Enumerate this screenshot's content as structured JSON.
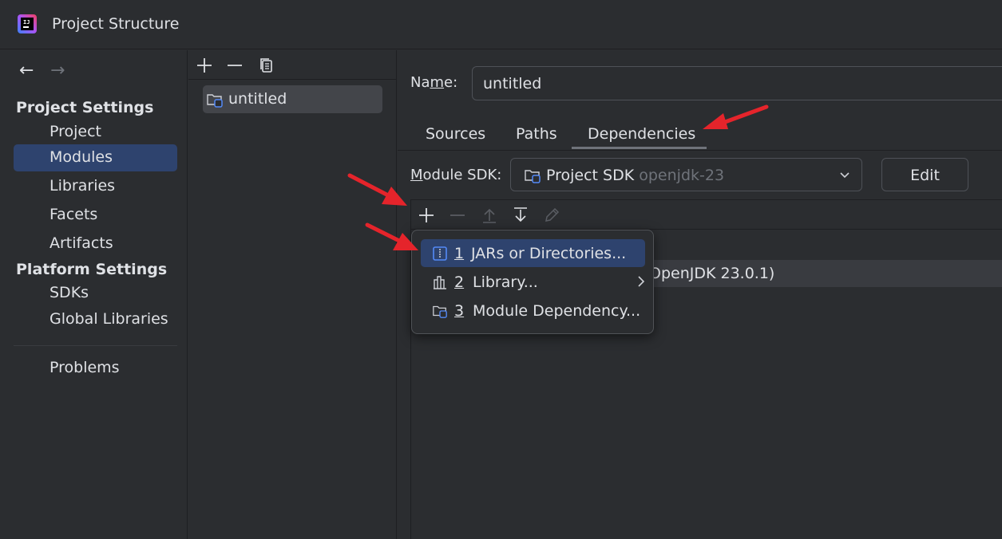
{
  "window": {
    "title": "Project Structure"
  },
  "nav": {
    "back_glyph": "←",
    "forward_glyph": "→",
    "project_settings_heading": "Project Settings",
    "project_settings_items": [
      "Project",
      "Modules",
      "Libraries",
      "Facets",
      "Artifacts"
    ],
    "platform_settings_heading": "Platform Settings",
    "platform_settings_items": [
      "SDKs",
      "Global Libraries"
    ],
    "problems": "Problems",
    "selected": "Modules"
  },
  "modules": {
    "items": [
      "untitled"
    ]
  },
  "module": {
    "name_label_pre": "Na",
    "name_label_mnemonic": "m",
    "name_label_post": "e:",
    "name_value": "untitled",
    "tabs": [
      "Sources",
      "Paths",
      "Dependencies"
    ],
    "active_tab": "Dependencies",
    "sdk_label_mnemonic": "M",
    "sdk_label_rest": "odule SDK:",
    "sdk_name": "Project SDK",
    "sdk_version": "openjdk-23",
    "edit_label": "Edit",
    "dependency_row_partial": "OpenJDK 23.0.1)"
  },
  "popup": {
    "items": [
      {
        "mnemonic": "1",
        "label": "JARs or Directories...",
        "icon": "jar-directory-icon"
      },
      {
        "mnemonic": "2",
        "label": "Library...",
        "icon": "library-icon"
      },
      {
        "mnemonic": "3",
        "label": "Module Dependency...",
        "icon": "module-folder-icon"
      }
    ]
  },
  "colors": {
    "background": "#2b2d30",
    "selection": "#2e436e",
    "annotation_arrow": "#e5242b"
  }
}
